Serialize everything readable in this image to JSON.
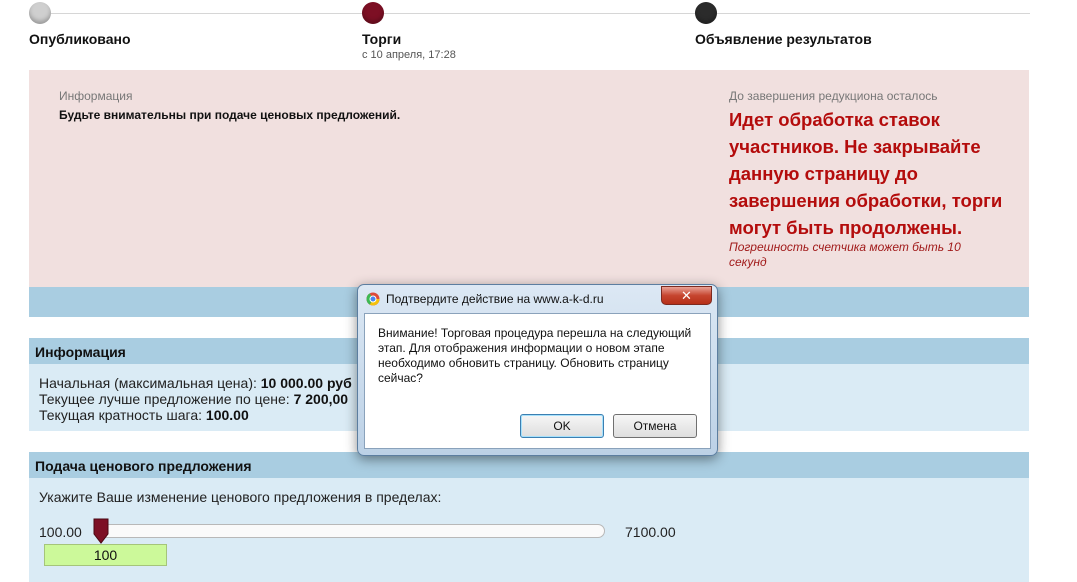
{
  "steps": [
    {
      "label": "Опубликовано",
      "sub": ""
    },
    {
      "label": "Торги",
      "sub": "с 10 апреля, 17:28"
    },
    {
      "label": "Объявление результатов",
      "sub": ""
    }
  ],
  "top_info": {
    "title": "Информация",
    "text": "Будьте внимательны при подаче ценовых предложений."
  },
  "countdown": {
    "title": "До завершения редукциона осталось",
    "message": "Идет обработка ставок участников. Не закрывайте данную страницу до завершения обработки, торги могут быть продолжены.",
    "note": "Погрешность счетчика может быть 10 секунд"
  },
  "info_panel": {
    "heading": "Информация",
    "lines": [
      {
        "label": "Начальная (максимальная цена): ",
        "value": "10 000.00 руб"
      },
      {
        "label": "Текущее лучше предложение по цене: ",
        "value": "7 200,00"
      },
      {
        "label": "Текущая кратность шага: ",
        "value": "100.00"
      }
    ]
  },
  "bid_panel": {
    "heading": "Подача ценового предложения",
    "prompt": "Укажите Ваше изменение ценового предложения в пределах:",
    "min": "100.00",
    "max": "7100.00",
    "slider_fraction": 0.0,
    "input_value": "100"
  },
  "dialog": {
    "title": "Подтвердите действие на www.a-k-d.ru",
    "close_label": "✕",
    "message": "Внимание! Торговая процедура перешла на следующий этап. Для отображения информации о новом этапе необходимо обновить страницу. Обновить страницу сейчас?",
    "ok_label": "OK",
    "cancel_label": "Отмена"
  },
  "colors": {
    "step_active": "#7d0f24",
    "alert_text": "#b40c0c",
    "panel_header": "#a9cde1",
    "panel_body": "#daebf5",
    "info_bg": "#f1e0df",
    "bid_input": "#ccf99a"
  },
  "icons": [
    "chrome-icon",
    "close-icon",
    "slider-thumb"
  ]
}
